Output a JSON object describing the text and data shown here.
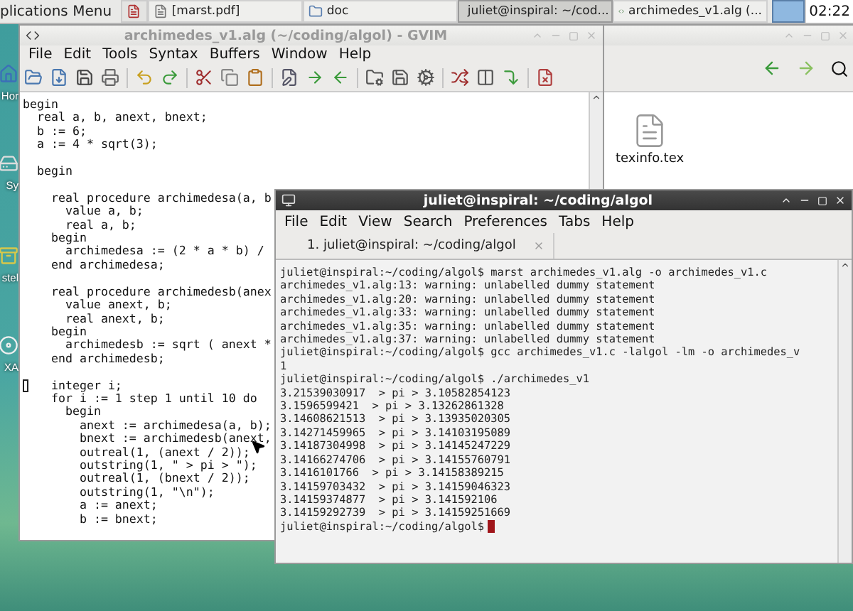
{
  "taskbar": {
    "items": [
      {
        "kind": "menu",
        "label": "plications Menu"
      },
      {
        "kind": "launcher"
      },
      {
        "kind": "window",
        "label": "[marst.pdf]",
        "selected": false
      },
      {
        "kind": "window",
        "label": "doc",
        "selected": false
      },
      {
        "kind": "window",
        "label": "juliet@inspiral: ~/cod...",
        "selected": true
      },
      {
        "kind": "window",
        "label": "archimedes_v1.alg (...",
        "selected": false
      },
      {
        "kind": "pager"
      },
      {
        "kind": "clock",
        "label": "02:22"
      }
    ]
  },
  "desktop_icons": [
    {
      "kind": "home",
      "label": "Hor"
    },
    {
      "kind": "drive",
      "label": "Sy"
    },
    {
      "kind": "archive",
      "label": "stel"
    },
    {
      "kind": "disc",
      "label": "XA"
    }
  ],
  "file_manager": {
    "files": [
      {
        "name": "texinfo.tex"
      }
    ]
  },
  "gvim": {
    "title": "archimedes_v1.alg (~/coding/algol) - GVIM",
    "menu": [
      "File",
      "Edit",
      "Tools",
      "Syntax",
      "Buffers",
      "Window",
      "Help"
    ],
    "lines": [
      {
        "text": "begin",
        "cursor": false
      },
      {
        "text": "  real a, b, anext, bnext;",
        "cursor": false
      },
      {
        "text": "  b := 6;",
        "cursor": false
      },
      {
        "text": "  a := 4 * sqrt(3);",
        "cursor": false
      },
      {
        "cursor": false
      },
      {
        "text": "  begin",
        "cursor": false
      },
      {
        "cursor": false
      },
      {
        "text": "    real procedure archimedesa(a, b",
        "cursor": false
      },
      {
        "text": "      value a, b;",
        "cursor": false
      },
      {
        "text": "      real a, b;",
        "cursor": false
      },
      {
        "text": "    begin",
        "cursor": false
      },
      {
        "text": "      archimedesa := (2 * a * b) /",
        "cursor": false
      },
      {
        "text": "    end archimedesa;",
        "cursor": false
      },
      {
        "cursor": false
      },
      {
        "text": "    real procedure archimedesb(anex",
        "cursor": false
      },
      {
        "text": "      value anext, b;",
        "cursor": false
      },
      {
        "text": "      real anext, b;",
        "cursor": false
      },
      {
        "text": "    begin",
        "cursor": false
      },
      {
        "text": "      archimedesb := sqrt ( anext *",
        "cursor": false
      },
      {
        "text": "    end archimedesb;",
        "cursor": false
      },
      {
        "cursor": false
      },
      {
        "text": "    integer i;",
        "cursor": true
      },
      {
        "text": "    for i := 1 step 1 until 10 do",
        "cursor": false
      },
      {
        "text": "      begin",
        "cursor": false
      },
      {
        "text": "        anext := archimedesa(a, b);",
        "cursor": false
      },
      {
        "text": "        bnext := archimedesb(anext,",
        "cursor": false
      },
      {
        "text": "        outreal(1, (anext / 2));",
        "cursor": false
      },
      {
        "text": "        outstring(1, \" > pi > \");",
        "cursor": false
      },
      {
        "text": "        outreal(1, (bnext / 2));",
        "cursor": false
      },
      {
        "text": "        outstring(1, \"\\n\");",
        "cursor": false
      },
      {
        "text": "        a := anext;",
        "cursor": false
      },
      {
        "text": "        b := bnext;",
        "cursor": false
      }
    ]
  },
  "terminal": {
    "title": "juliet@inspiral: ~/coding/algol",
    "menu": [
      "File",
      "Edit",
      "View",
      "Search",
      "Preferences",
      "Tabs",
      "Help"
    ],
    "tabs": [
      {
        "label": "1. juliet@inspiral: ~/coding/algol",
        "selected": true
      }
    ],
    "lines": [
      "juliet@inspiral:~/coding/algol$ marst archimedes_v1.alg -o archimedes_v1.c",
      "archimedes_v1.alg:13: warning: unlabelled dummy statement",
      "archimedes_v1.alg:20: warning: unlabelled dummy statement",
      "archimedes_v1.alg:33: warning: unlabelled dummy statement",
      "archimedes_v1.alg:35: warning: unlabelled dummy statement",
      "archimedes_v1.alg:37: warning: unlabelled dummy statement",
      "juliet@inspiral:~/coding/algol$ gcc archimedes_v1.c -lalgol -lm -o archimedes_v",
      "1",
      "juliet@inspiral:~/coding/algol$ ./archimedes_v1",
      "3.21539030917  > pi > 3.10582854123",
      "3.1596599421  > pi > 3.13262861328",
      "3.14608621513  > pi > 3.13935020305",
      "3.14271459965  > pi > 3.14103195089",
      "3.14187304998  > pi > 3.14145247229",
      "3.14166274706  > pi > 3.14155760791",
      "3.1416101766  > pi > 3.14158389215",
      "3.14159703432  > pi > 3.14159046323",
      "3.14159374877  > pi > 3.141592106",
      "3.14159292739  > pi > 3.14159251669"
    ],
    "prompt": "juliet@inspiral:~/coding/algol$"
  }
}
